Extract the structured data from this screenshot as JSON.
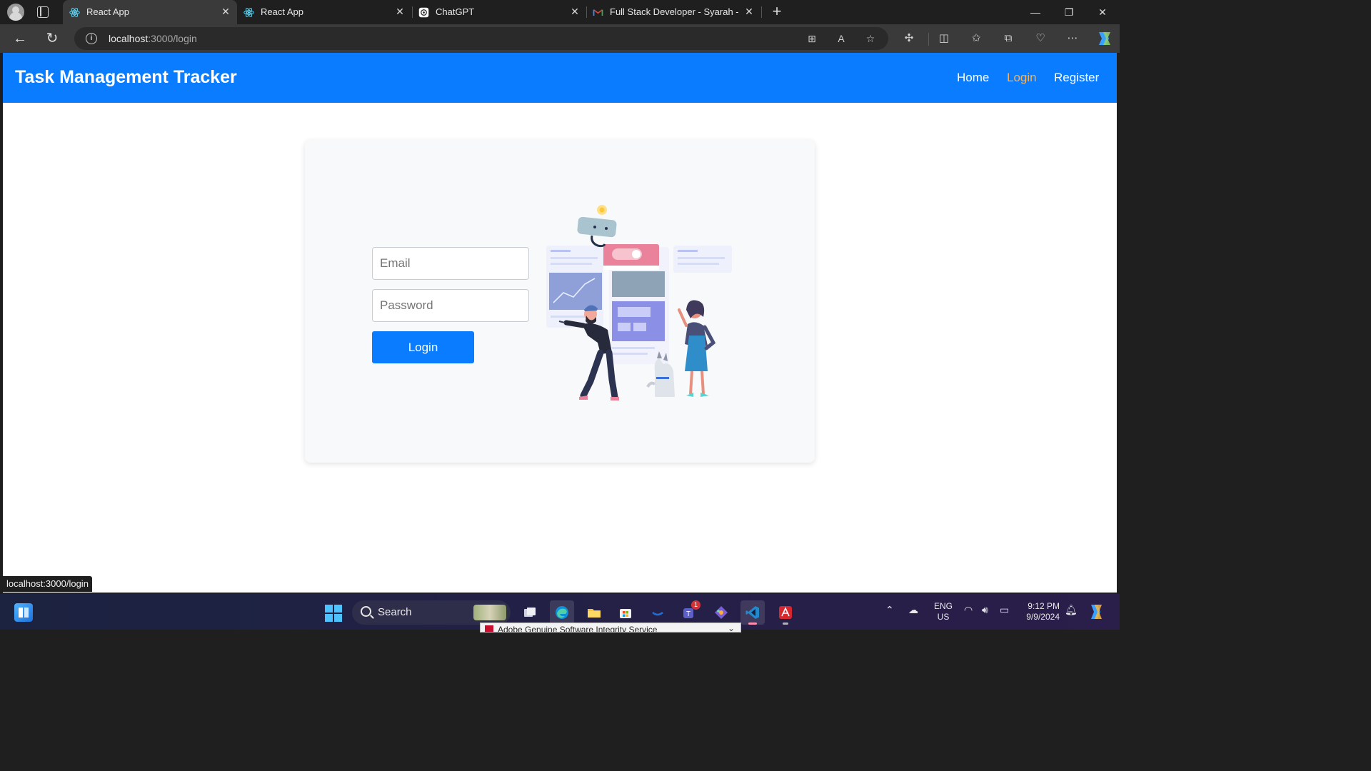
{
  "browser": {
    "tabs": [
      {
        "title": "React App",
        "favicon": "react-icon",
        "active": true
      },
      {
        "title": "React App",
        "favicon": "react-icon",
        "active": false
      },
      {
        "title": "ChatGPT",
        "favicon": "chatgpt-icon",
        "active": false
      },
      {
        "title": "Full Stack Developer - Syarah - ro",
        "favicon": "gmail-icon",
        "active": false
      }
    ],
    "address": {
      "host": "localhost",
      "path": ":3000/login"
    },
    "status_url": "localhost:3000/login"
  },
  "app": {
    "brand": "Task Management Tracker",
    "nav": [
      {
        "label": "Home",
        "current": false
      },
      {
        "label": "Login",
        "current": true
      },
      {
        "label": "Register",
        "current": false
      }
    ],
    "colors": {
      "primary": "#0a7cff",
      "nav_active": "#ffb04a",
      "card_bg": "#f8f9fa"
    }
  },
  "login_form": {
    "email_placeholder": "Email",
    "password_placeholder": "Password",
    "submit_label": "Login"
  },
  "taskbar": {
    "search_label": "Search",
    "apps": [
      "file-explorer-icon",
      "edge-icon",
      "folder-icon",
      "store-icon",
      "dell-icon",
      "teams-icon",
      "git-icon",
      "vscode-icon",
      "acrobat-icon"
    ],
    "teams_badge": "1",
    "popup_title": "Adobe Genuine Software Integrity Service",
    "language": {
      "line1": "ENG",
      "line2": "US"
    },
    "clock": {
      "time": "9:12 PM",
      "date": "9/9/2024"
    }
  }
}
